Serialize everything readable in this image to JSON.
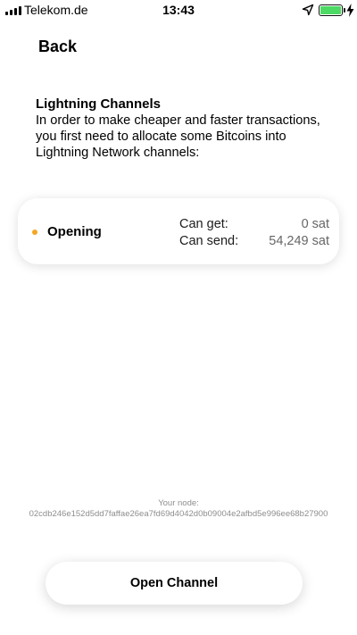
{
  "status_bar": {
    "carrier": "Telekom.de",
    "time": "13:43",
    "icons": [
      "signal-icon",
      "location-arrow-icon",
      "battery-icon",
      "charging-bolt-icon"
    ],
    "battery_color": "#4cd964"
  },
  "nav": {
    "back_label": "Back"
  },
  "info": {
    "title": "Lightning Channels",
    "text": "In order to make cheaper and faster transactions, you first need to allocate some Bitcoins into Lightning Network channels:"
  },
  "channel": {
    "status": "Opening",
    "status_color": "#f5a623",
    "can_get_label": "Can get:",
    "can_get_value": "0 sat",
    "can_send_label": "Can send:",
    "can_send_value": "54,249 sat"
  },
  "node": {
    "label": "Your node:",
    "id": "02cdb246e152d5dd7faffae26ea7fd69d4042d0b09004e2afbd5e996ee68b27900"
  },
  "actions": {
    "open_channel_label": "Open Channel"
  }
}
